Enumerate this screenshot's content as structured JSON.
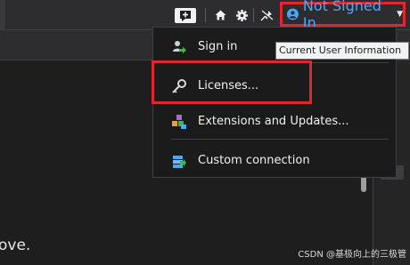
{
  "toolbar": {
    "feedback_icon": "feedback-plus-icon",
    "home_icon": "home-icon",
    "gear_icon": "gear-icon",
    "pin_icon": "pin-off-icon",
    "user_button": {
      "label": "Not Signed In",
      "icon": "user-avatar-icon",
      "accent": "#4aa8ff"
    }
  },
  "user_menu": {
    "items": [
      {
        "label": "Sign in",
        "icon": "sign-in-icon"
      },
      {
        "label": "Licenses...",
        "icon": "key-icon"
      },
      {
        "label": "Extensions and Updates...",
        "icon": "extensions-icon"
      },
      {
        "label": "Custom connection",
        "icon": "custom-connection-icon"
      }
    ]
  },
  "tooltip": {
    "text": "Current User Information"
  },
  "background": {
    "partial_text": "ove."
  },
  "watermark": {
    "text": "CSDN @基极向上的三极管"
  },
  "colors": {
    "highlight_red": "#e0262f",
    "bg_dark": "#1e1e1e",
    "menu_bg": "#1b1b1c"
  }
}
